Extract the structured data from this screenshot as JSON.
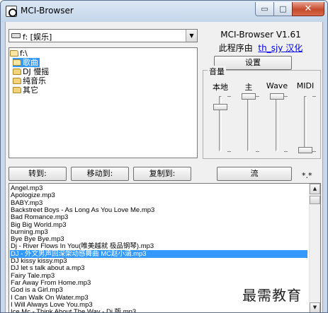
{
  "window": {
    "title": "MCI-Browser",
    "minimize_symbol": "▭",
    "maximize_symbol": "□",
    "close_symbol": "✕"
  },
  "drive": {
    "selected": "f: [娱乐]",
    "arrow": "▼"
  },
  "folders": [
    {
      "label": "f:\\",
      "selected": false,
      "indent": 0,
      "open": true
    },
    {
      "label": "歌曲",
      "selected": true,
      "indent": 1,
      "open": true
    },
    {
      "label": "DJ 慢摇",
      "selected": false,
      "indent": 1,
      "open": false
    },
    {
      "label": "纯音乐",
      "selected": false,
      "indent": 1,
      "open": false
    },
    {
      "label": "其它",
      "selected": false,
      "indent": 1,
      "open": false
    }
  ],
  "info": {
    "version": "MCI-Browser V1.61",
    "author_prefix": "此程序由",
    "author_link": "th_sjy 汉化",
    "settings_label": "设置"
  },
  "volume": {
    "title": "音量",
    "channels": [
      {
        "label": "本地",
        "level": 0.8
      },
      {
        "label": "主",
        "level": 1.0
      },
      {
        "label": "Wave",
        "level": 1.0
      },
      {
        "label": "MIDI",
        "level": 0.0
      }
    ]
  },
  "actions": {
    "goto_label": "转到:",
    "move_label": "移动到:",
    "copy_label": "复制到:",
    "stream_label": "流",
    "star_label": "*.*"
  },
  "files": [
    {
      "name": "Angel.mp3",
      "selected": false
    },
    {
      "name": "Apologize.mp3",
      "selected": false
    },
    {
      "name": "BABY.mp3",
      "selected": false
    },
    {
      "name": "Backstreet Boys - As Long As You Love Me.mp3",
      "selected": false
    },
    {
      "name": "Bad Romance.mp3",
      "selected": false
    },
    {
      "name": "Big Big World.mp3",
      "selected": false
    },
    {
      "name": "burning.mp3",
      "selected": false
    },
    {
      "name": "Bye Bye Bye.mp3",
      "selected": false
    },
    {
      "name": "Dj - River Flows In You(唯美越就 极品钢琴).mp3",
      "selected": false
    },
    {
      "name": "DJ - 外文男声回深架动感舞曲 MC赵小涵.mp3",
      "selected": true
    },
    {
      "name": "DJ kissy kissy.mp3",
      "selected": false
    },
    {
      "name": "DJ let s talk about a.mp3",
      "selected": false
    },
    {
      "name": "Fairy Tale.mp3",
      "selected": false
    },
    {
      "name": "Far Away From Home.mp3",
      "selected": false
    },
    {
      "name": "God is a Girl.mp3",
      "selected": false
    },
    {
      "name": "I Can Walk On Water.mp3",
      "selected": false
    },
    {
      "name": "I Will Always Love You.mp3",
      "selected": false
    },
    {
      "name": "Ice Mc - Think About The Way - Dj 版.mp3",
      "selected": false
    }
  ],
  "scroll": {
    "up": "▲",
    "down": "▼"
  },
  "watermark": "最需教育"
}
